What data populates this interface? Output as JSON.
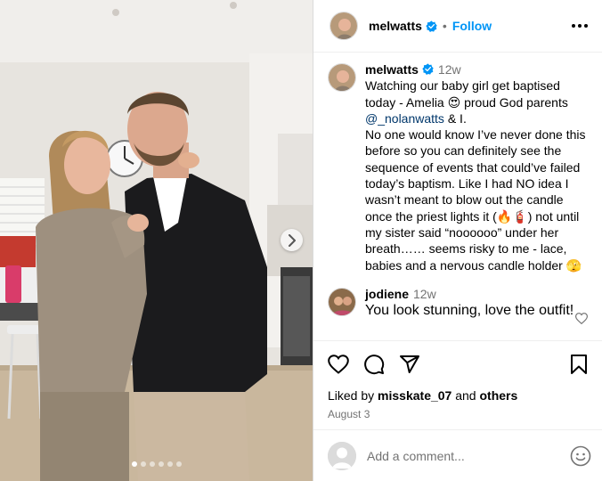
{
  "post": {
    "username": "melwatts",
    "follow_label": "Follow",
    "separator": "•"
  },
  "caption": {
    "username": "melwatts",
    "time": "12w",
    "line1": "Watching our baby girl get baptised today - Amelia 😍 proud God parents",
    "mention": "@_nolanwatts",
    "line1_end": " & I.",
    "paragraph2": "No one would know I’ve never done this before so you can definitely see the sequence of events that could’ve failed today’s baptism. Like I had NO idea I wasn’t meant to blow out the candle once the priest lights it (🔥🧯) not until my sister said “noooooo” under her breath…… seems risky to me - lace, babies and a nervous candle holder 🫣"
  },
  "reply": {
    "username": "jodiene",
    "time": "12w",
    "text": "You look stunning, love the outfit!"
  },
  "likes": {
    "prefix": "Liked by ",
    "user": "misskate_07",
    "middle": " and ",
    "others": "others"
  },
  "date": "August 3",
  "add_comment": {
    "placeholder": "Add a comment..."
  },
  "carousel": {
    "dot_count": 6,
    "active_index": 0
  },
  "icons": {
    "verified": "verified-badge-icon",
    "more": "more-options-icon",
    "like": "heart-icon",
    "comment": "comment-icon",
    "share": "share-icon",
    "save": "bookmark-icon",
    "emoji": "emoji-icon",
    "next": "chevron-right-icon"
  },
  "colors": {
    "accent": "#0095f6",
    "mention": "#00376b",
    "verified": "#0095f6",
    "muted": "#737373"
  }
}
